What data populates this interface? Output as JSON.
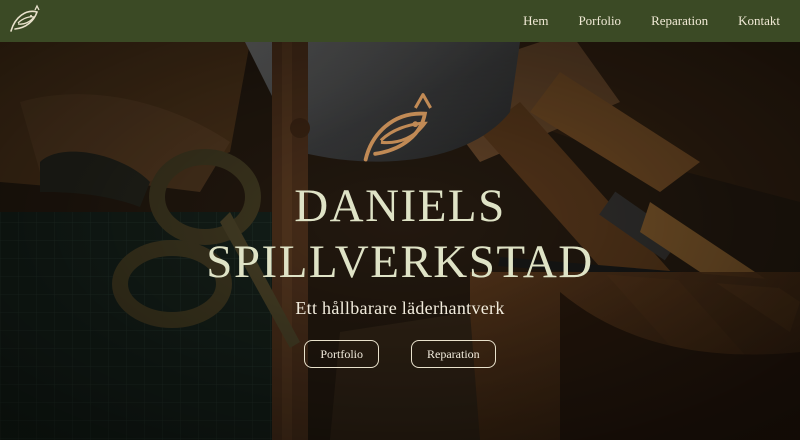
{
  "nav": {
    "logo_icon": "fish-logo-icon",
    "links": [
      "Hem",
      "Porfolio",
      "Reparation",
      "Kontakt"
    ]
  },
  "hero": {
    "title_line1": "DANIELS",
    "title_line2": "SPILLVERKSTAD",
    "subtitle": "Ett hållbarare läderhantverk",
    "buttons": [
      "Portfolio",
      "Reparation"
    ],
    "emblem_icon": "fish-emblem-icon"
  },
  "colors": {
    "nav_bg": "#3b4a25",
    "title": "#dfe3c6",
    "text": "#f2ecdd",
    "copper": "#c18a55"
  }
}
